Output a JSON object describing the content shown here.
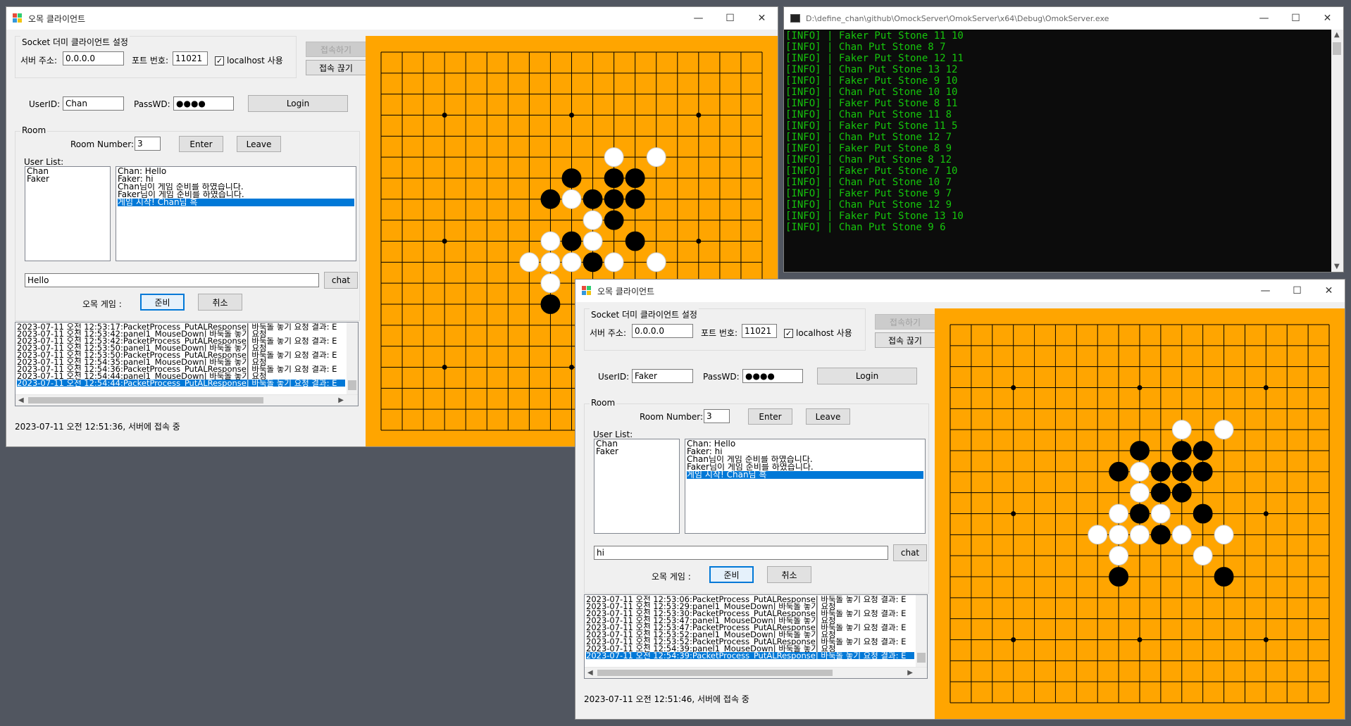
{
  "desktop": {
    "background": "#515660"
  },
  "board_colors": {
    "board": "#ffa500",
    "line": "#000000",
    "black_stone": "#000000",
    "white_stone": "#ffffff"
  },
  "console": {
    "title": "D:\\define_chan\\github\\OmockServer\\OmokServer\\x64\\Debug\\OmokServer.exe",
    "lines": [
      "[INFO] | Faker Put Stone 11 10",
      "[INFO] | Chan Put Stone 8 7",
      "[INFO] | Faker Put Stone 12 11",
      "[INFO] | Chan Put Stone 13 12",
      "[INFO] | Faker Put Stone 9 10",
      "[INFO] | Chan Put Stone 10 10",
      "[INFO] | Faker Put Stone 8 11",
      "[INFO] | Chan Put Stone 11 8",
      "[INFO] | Faker Put Stone 11 5",
      "[INFO] | Chan Put Stone 12 7",
      "[INFO] | Faker Put Stone 8 9",
      "[INFO] | Chan Put Stone 8 12",
      "[INFO] | Faker Put Stone 7 10",
      "[INFO] | Chan Put Stone 10 7",
      "[INFO] | Faker Put Stone 9 7",
      "[INFO] | Chan Put Stone 12 9",
      "[INFO] | Faker Put Stone 13 10",
      "[INFO] | Chan Put Stone 9 6"
    ]
  },
  "client1": {
    "title": "오목 클라이언트",
    "settings_group": "Socket 더미 클라이언트 설정",
    "server_addr_label": "서버 주소:",
    "server_addr": "0.0.0.0",
    "port_label": "포트 번호:",
    "port": "11021",
    "localhost_label": "localhost 사용",
    "connect_label": "접속하기",
    "disconnect_label": "접속 끊기",
    "userid_label": "UserID:",
    "userid": "Chan",
    "passwd_label": "PassWD:",
    "passwd": "●●●●",
    "login_label": "Login",
    "room_group": "Room",
    "room_number_label": "Room Number:",
    "room_number": "3",
    "enter_label": "Enter",
    "leave_label": "Leave",
    "user_list_label": "User List:",
    "users": [
      "Chan",
      "Faker"
    ],
    "chat_lines": [
      "Chan: Hello",
      "Faker: hi",
      "Chan님이 게임 준비를 하였습니다.",
      "Faker님이 게임 준비를 하였습니다.",
      "게임 시작! Chan님 흑"
    ],
    "chat_input": "Hello",
    "chat_button": "chat",
    "omok_game_label": "오목 게임 :",
    "ready_label": "준비",
    "cancel_label": "취소",
    "logs": [
      "2023-07-11 오전 12:53:17:PacketProcess_PutALResponse| 바둑돌 놓기 요청 결과: E",
      "2023-07-11 오전 12:53:42:panel1_MouseDown| 바둑돌 놓기 요청",
      "2023-07-11 오전 12:53:42:PacketProcess_PutALResponse| 바둑돌 놓기 요청 결과: E",
      "2023-07-11 오전 12:53:50:panel1_MouseDown| 바둑돌 놓기 요청",
      "2023-07-11 오전 12:53:50:PacketProcess_PutALResponse| 바둑돌 놓기 요청 결과: E",
      "2023-07-11 오전 12:54:35:panel1_MouseDown| 바둑돌 놓기 요청",
      "2023-07-11 오전 12:54:36:PacketProcess_PutALResponse| 바둑돌 놓기 요청 결과: E",
      "2023-07-11 오전 12:54:44:panel1_MouseDown| 바둑돌 놓기 요청",
      "2023-07-11 오전 12:54:44:PacketProcess_PutALResponse| 바둑돌 놓기 요청 결과: E"
    ],
    "status": "2023-07-11 오전 12:51:36, 서버에 접속 중",
    "stones": [
      {
        "c": "w",
        "x": 11,
        "y": 5
      },
      {
        "c": "w",
        "x": 13,
        "y": 5
      },
      {
        "c": "b",
        "x": 9,
        "y": 6
      },
      {
        "c": "b",
        "x": 11,
        "y": 6
      },
      {
        "c": "b",
        "x": 12,
        "y": 6
      },
      {
        "c": "b",
        "x": 8,
        "y": 7
      },
      {
        "c": "w",
        "x": 9,
        "y": 7
      },
      {
        "c": "b",
        "x": 10,
        "y": 7
      },
      {
        "c": "b",
        "x": 11,
        "y": 7
      },
      {
        "c": "b",
        "x": 12,
        "y": 7
      },
      {
        "c": "w",
        "x": 10,
        "y": 8
      },
      {
        "c": "b",
        "x": 11,
        "y": 8
      },
      {
        "c": "w",
        "x": 8,
        "y": 9
      },
      {
        "c": "b",
        "x": 9,
        "y": 9
      },
      {
        "c": "w",
        "x": 10,
        "y": 9
      },
      {
        "c": "b",
        "x": 12,
        "y": 9
      },
      {
        "c": "w",
        "x": 7,
        "y": 10
      },
      {
        "c": "w",
        "x": 8,
        "y": 10
      },
      {
        "c": "w",
        "x": 9,
        "y": 10
      },
      {
        "c": "b",
        "x": 10,
        "y": 10
      },
      {
        "c": "w",
        "x": 11,
        "y": 10
      },
      {
        "c": "w",
        "x": 13,
        "y": 10
      },
      {
        "c": "w",
        "x": 8,
        "y": 11
      },
      {
        "c": "b",
        "x": 8,
        "y": 12
      }
    ]
  },
  "client2": {
    "title": "오목 클라이언트",
    "settings_group": "Socket 더미 클라이언트 설정",
    "server_addr_label": "서버 주소:",
    "server_addr": "0.0.0.0",
    "port_label": "포트 번호:",
    "port": "11021",
    "localhost_label": "localhost 사용",
    "connect_label": "접속하기",
    "disconnect_label": "접속 끊기",
    "userid_label": "UserID:",
    "userid": "Faker",
    "passwd_label": "PassWD:",
    "passwd": "●●●●",
    "login_label": "Login",
    "room_group": "Room",
    "room_number_label": "Room Number:",
    "room_number": "3",
    "enter_label": "Enter",
    "leave_label": "Leave",
    "user_list_label": "User List:",
    "users": [
      "Chan",
      "Faker"
    ],
    "chat_lines": [
      "Chan: Hello",
      "Faker: hi",
      "Chan님이 게임 준비를 하였습니다.",
      "Faker님이 게임 준비를 하였습니다.",
      "게임 시작! Chan님 흑"
    ],
    "chat_input": "hi",
    "chat_button": "chat",
    "omok_game_label": "오목 게임 :",
    "ready_label": "준비",
    "cancel_label": "취소",
    "logs": [
      "2023-07-11 오전 12:53:06:PacketProcess_PutALResponse| 바둑돌 놓기 요청 결과: E",
      "2023-07-11 오전 12:53:29:panel1_MouseDown| 바둑돌 놓기 요청",
      "2023-07-11 오전 12:53:30:PacketProcess_PutALResponse| 바둑돌 놓기 요청 결과: E",
      "2023-07-11 오전 12:53:47:panel1_MouseDown| 바둑돌 놓기 요청",
      "2023-07-11 오전 12:53:47:PacketProcess_PutALResponse| 바둑돌 놓기 요청 결과: E",
      "2023-07-11 오전 12:53:52:panel1_MouseDown| 바둑돌 놓기 요청",
      "2023-07-11 오전 12:53:52:PacketProcess_PutALResponse| 바둑돌 놓기 요청 결과: E",
      "2023-07-11 오전 12:54:39:panel1_MouseDown| 바둑돌 놓기 요청",
      "2023-07-11 오전 12:54:39:PacketProcess_PutALResponse| 바둑돌 놓기 요청 결과: E"
    ],
    "status": "2023-07-11 오전 12:51:46, 서버에 접속 중",
    "stones": [
      {
        "c": "w",
        "x": 11,
        "y": 5
      },
      {
        "c": "w",
        "x": 13,
        "y": 5
      },
      {
        "c": "b",
        "x": 9,
        "y": 6
      },
      {
        "c": "b",
        "x": 11,
        "y": 6
      },
      {
        "c": "b",
        "x": 12,
        "y": 6
      },
      {
        "c": "b",
        "x": 8,
        "y": 7
      },
      {
        "c": "w",
        "x": 9,
        "y": 7
      },
      {
        "c": "b",
        "x": 10,
        "y": 7
      },
      {
        "c": "b",
        "x": 11,
        "y": 7
      },
      {
        "c": "b",
        "x": 12,
        "y": 7
      },
      {
        "c": "w",
        "x": 9,
        "y": 8
      },
      {
        "c": "b",
        "x": 10,
        "y": 8
      },
      {
        "c": "b",
        "x": 11,
        "y": 8
      },
      {
        "c": "w",
        "x": 8,
        "y": 9
      },
      {
        "c": "b",
        "x": 9,
        "y": 9
      },
      {
        "c": "w",
        "x": 10,
        "y": 9
      },
      {
        "c": "b",
        "x": 12,
        "y": 9
      },
      {
        "c": "w",
        "x": 7,
        "y": 10
      },
      {
        "c": "w",
        "x": 8,
        "y": 10
      },
      {
        "c": "w",
        "x": 9,
        "y": 10
      },
      {
        "c": "b",
        "x": 10,
        "y": 10
      },
      {
        "c": "w",
        "x": 11,
        "y": 10
      },
      {
        "c": "w",
        "x": 13,
        "y": 10
      },
      {
        "c": "w",
        "x": 8,
        "y": 11
      },
      {
        "c": "w",
        "x": 12,
        "y": 11
      },
      {
        "c": "b",
        "x": 8,
        "y": 12
      },
      {
        "c": "b",
        "x": 13,
        "y": 12
      }
    ]
  }
}
